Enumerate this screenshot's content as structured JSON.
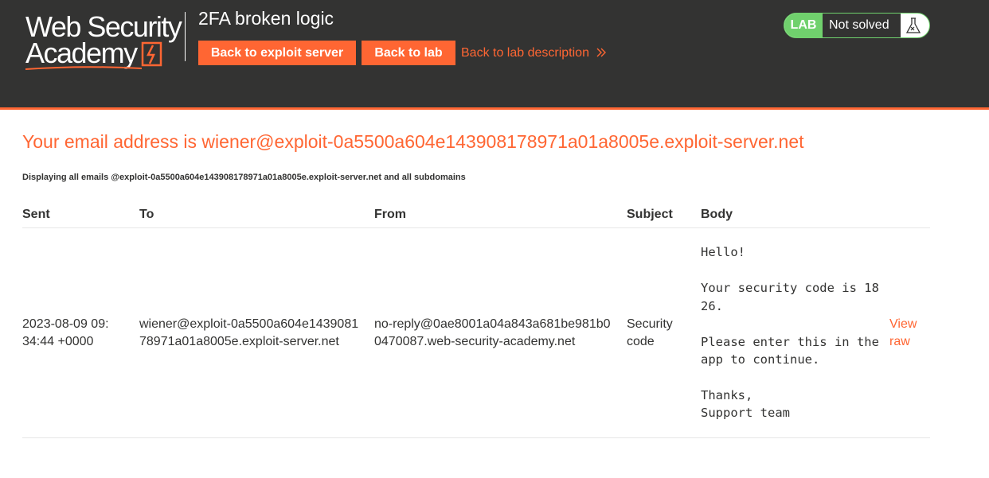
{
  "header": {
    "logo_line1": "Web Security",
    "logo_line2": "Academy",
    "lab_title": "2FA broken logic",
    "back_to_exploit_server": "Back to exploit server",
    "back_to_lab": "Back to lab",
    "back_to_lab_description": "Back to lab description",
    "status_tag": "LAB",
    "status_text": "Not solved",
    "icons": {
      "logo": "bolt-icon",
      "status": "flask-icon",
      "link_arrow": "double-chevron-right-icon"
    },
    "colors": {
      "accent": "#ff6633",
      "header_bg": "#333332",
      "solved_green": "#70d16d"
    }
  },
  "main": {
    "email_heading": "Your email address is wiener@exploit-0a5500a604e143908178971a01a8005e.exploit-server.net",
    "subnote": "Displaying all emails @exploit-0a5500a604e143908178971a01a8005e.exploit-server.net and all subdomains",
    "table": {
      "headers": {
        "sent": "Sent",
        "to": "To",
        "from": "From",
        "subject": "Subject",
        "body": "Body"
      },
      "rows": [
        {
          "sent": "2023-08-09 09:34:44 +0000",
          "to": "wiener@exploit-0a5500a604e143908178971a01a8005e.exploit-server.net",
          "from": "no-reply@0ae8001a04a843a681be981b00470087.web-security-academy.net",
          "subject": "Security code",
          "body": "Hello!\n\nYour security code is 1826.\n\nPlease enter this in the app to continue.\n\nThanks,\nSupport team",
          "view_raw": "View raw"
        }
      ]
    }
  }
}
